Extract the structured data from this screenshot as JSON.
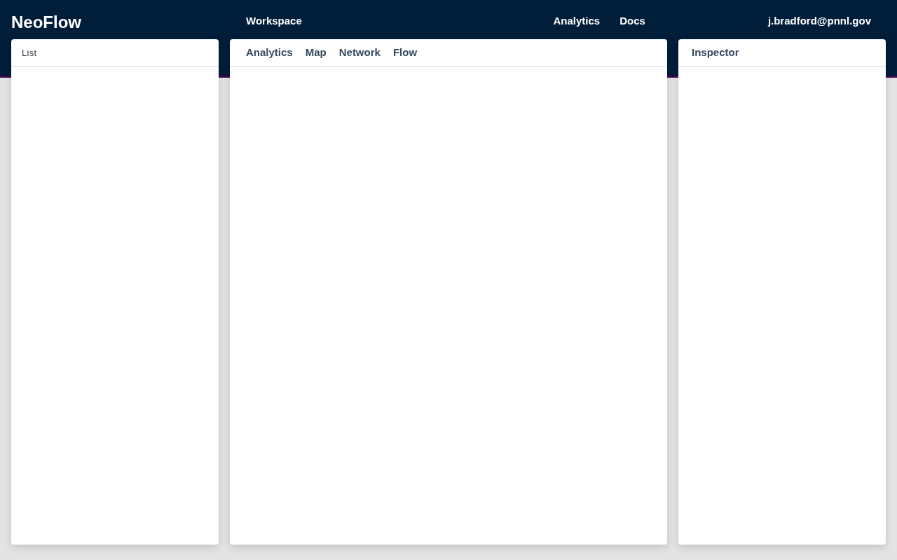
{
  "header": {
    "logo": "NeoFlow",
    "nav_left": [
      "Workspace"
    ],
    "nav_right": [
      "Analytics",
      "Docs"
    ],
    "user": "j.bradford@pnnl.gov"
  },
  "panels": {
    "left": {
      "title": "List"
    },
    "center": {
      "tabs": [
        "Analytics",
        "Map",
        "Network",
        "Flow"
      ]
    },
    "right": {
      "title": "Inspector"
    }
  }
}
